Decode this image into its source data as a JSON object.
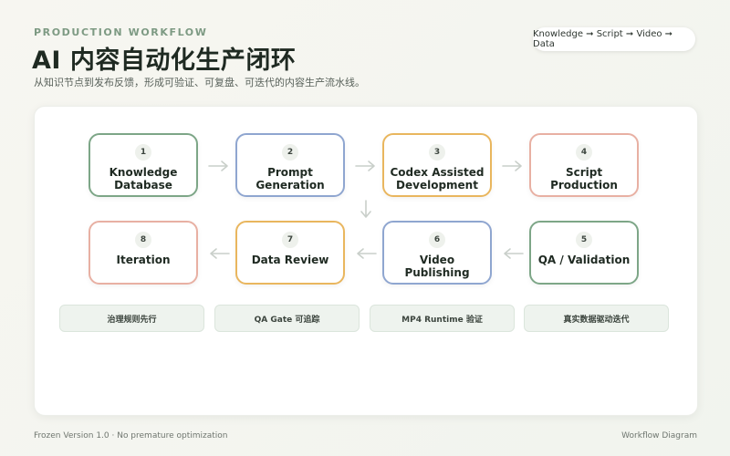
{
  "header": {
    "eyebrow": "PRODUCTION WORKFLOW",
    "title": "AI 内容自动化生产闭环",
    "subtitle": "从知识节点到发布反馈，形成可验证、可复盘、可迭代的内容生产流水线。",
    "pill": "Knowledge ➞ Script ➞ Video ➞ Data"
  },
  "colors": {
    "green": "#7da687",
    "blue": "#8fa6d0",
    "orange": "#e9b65e",
    "pink": "#e8b0a3",
    "arrow": "#c9cfca"
  },
  "nodes": [
    {
      "num": "1",
      "label": "Knowledge Database",
      "color": "green"
    },
    {
      "num": "2",
      "label": "Prompt Generation",
      "color": "blue"
    },
    {
      "num": "3",
      "label": "Codex Assisted Development",
      "color": "orange"
    },
    {
      "num": "4",
      "label": "Script Production",
      "color": "pink"
    },
    {
      "num": "5",
      "label": "QA / Validation",
      "color": "green"
    },
    {
      "num": "6",
      "label": "Video Publishing",
      "color": "blue"
    },
    {
      "num": "7",
      "label": "Data Review",
      "color": "orange"
    },
    {
      "num": "8",
      "label": "Iteration",
      "color": "pink"
    }
  ],
  "tags": [
    "治理规则先行",
    "QA Gate 可追踪",
    "MP4 Runtime 验证",
    "真实数据驱动迭代"
  ],
  "footer": {
    "left": "Frozen Version 1.0 · No premature optimization",
    "right": "Workflow Diagram"
  }
}
